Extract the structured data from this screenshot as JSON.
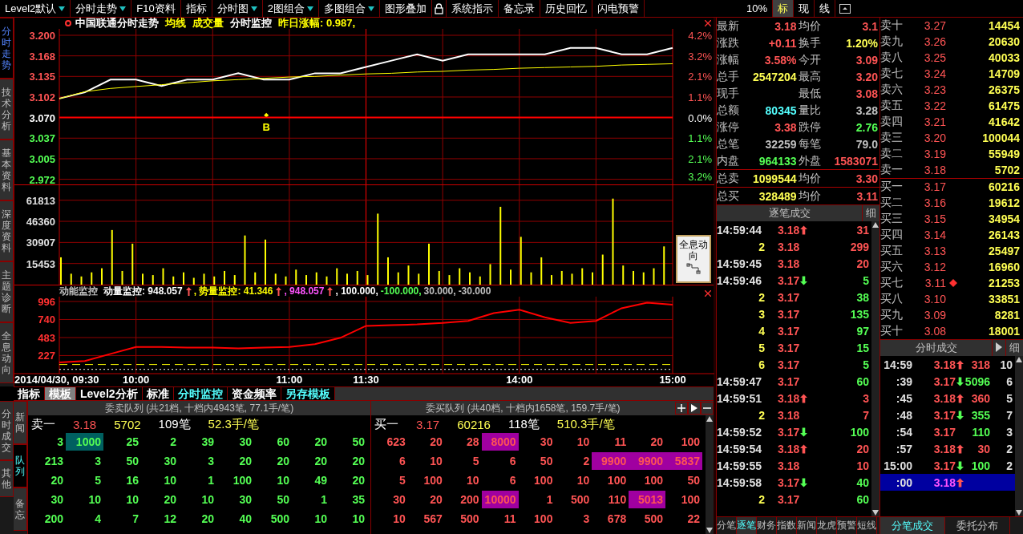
{
  "toolbar": [
    {
      "kind": "button",
      "label": "Level2默认",
      "dropdown": true
    },
    {
      "kind": "button",
      "label": "分时走势",
      "dropdown": true
    },
    {
      "kind": "button",
      "label": "F10资料",
      "dropdown": false
    },
    {
      "kind": "button",
      "label": "指标",
      "dropdown": false
    },
    {
      "kind": "button",
      "label": "分时图",
      "dropdown": true
    },
    {
      "kind": "button",
      "label": "2图组合",
      "dropdown": true
    },
    {
      "kind": "button",
      "label": "多图组合",
      "dropdown": true
    },
    {
      "kind": "button",
      "label": "图形叠加",
      "dropdown": false
    },
    {
      "kind": "lock"
    },
    {
      "kind": "button",
      "label": "系统指示",
      "dropdown": false
    },
    {
      "kind": "button",
      "label": "备忘录",
      "dropdown": false
    },
    {
      "kind": "button",
      "label": "历史回忆",
      "dropdown": false
    },
    {
      "kind": "button",
      "label": "闪电预警",
      "dropdown": false
    }
  ],
  "view": {
    "zoom": "10%",
    "modes": [
      {
        "label": "标",
        "selected": true
      },
      {
        "label": "现",
        "selected": false
      },
      {
        "label": "线",
        "selected": false
      }
    ]
  },
  "side_tabs": [
    {
      "label": "分时走势",
      "selected": true
    },
    {
      "label": "技术分析",
      "selected": false
    },
    {
      "label": "基本资料",
      "selected": false
    },
    {
      "label": "深度资料",
      "selected": false
    },
    {
      "label": "主题诊断",
      "selected": false
    },
    {
      "label": "全息动向",
      "selected": false
    }
  ],
  "chart_header": {
    "title": "中国联通分时走势",
    "items": [
      {
        "text": "成交量",
        "color": "#ffff00"
      },
      {
        "text": "分时监控",
        "color": "#ffffff"
      },
      {
        "text": "昨日涨幅: 0.987,",
        "color": "#ffff00"
      }
    ]
  },
  "price_chart": {
    "right_axis": [
      "4.2%",
      "3.2%",
      "2.1%",
      "1.1%",
      "0.0%",
      "1.1%",
      "2.1%",
      "3.2%"
    ],
    "marker": {
      "label": "B"
    },
    "chart_data": {
      "type": "line",
      "grid": true,
      "categories": [
        null,
        null,
        null,
        null,
        null,
        null,
        null,
        null,
        null,
        null,
        null,
        null,
        null,
        null,
        null,
        null,
        null,
        null,
        null,
        null,
        null,
        null,
        null,
        null,
        null
      ],
      "series": [
        {
          "color": "#ffffff",
          "values": [
            3.1,
            3.11,
            3.13,
            3.13,
            3.12,
            3.13,
            3.13,
            3.14,
            3.13,
            3.13,
            3.14,
            3.14,
            3.15,
            3.16,
            3.17,
            3.16,
            3.17,
            3.17,
            3.17,
            3.17,
            3.18,
            3.18,
            3.17,
            3.17,
            3.18
          ]
        },
        {
          "name": "均线",
          "color": "#ffff00",
          "values": [
            3.1,
            3.111,
            3.116,
            3.119,
            3.122,
            3.125,
            3.128,
            3.13,
            3.132,
            3.134,
            3.135,
            3.137,
            3.139,
            3.14,
            3.142,
            3.143,
            3.145,
            3.146,
            3.148,
            3.149,
            3.15,
            3.151,
            3.153,
            3.154,
            3.155
          ]
        },
        {
          "color": "#ff0000",
          "values": [
            3.07,
            3.07,
            3.07,
            3.07,
            3.07,
            3.07,
            3.07,
            3.07,
            3.07,
            3.07,
            3.07,
            3.07,
            3.07,
            3.07,
            3.07,
            3.07,
            3.07,
            3.07,
            3.07,
            3.07,
            3.07,
            3.07,
            3.07,
            3.07,
            3.07
          ]
        }
      ],
      "ylim": [
        2.972,
        3.2
      ],
      "yticks": [
        {
          "value": 3.2,
          "label": "3.200"
        },
        {
          "value": 3.1675,
          "label": "3.168"
        },
        {
          "value": 3.135,
          "label": "3.135"
        },
        {
          "value": 3.1025,
          "label": "3.102"
        },
        {
          "value": 3.07,
          "label": "3.070"
        },
        {
          "value": 3.0375,
          "label": "3.037"
        },
        {
          "value": 3.005,
          "label": "3.005"
        },
        {
          "value": 2.9725,
          "label": "2.972"
        }
      ]
    }
  },
  "volume_chart": {
    "chart_data": {
      "type": "bar",
      "grid": true,
      "categories": [
        null,
        null,
        null,
        null,
        null,
        null,
        null,
        null,
        null,
        null,
        null,
        null,
        null,
        null,
        null,
        null,
        null,
        null,
        null,
        null,
        null,
        null,
        null,
        null,
        null,
        null,
        null,
        null,
        null,
        null,
        null,
        null,
        null,
        null,
        null,
        null,
        null,
        null,
        null,
        null,
        null,
        null,
        null,
        null,
        null,
        null,
        null,
        null,
        null,
        null,
        null,
        null,
        null,
        null,
        null,
        null,
        null,
        null,
        null,
        null
      ],
      "values": [
        20000,
        8000,
        6000,
        9000,
        12000,
        40000,
        10000,
        30000,
        8000,
        7000,
        12000,
        6000,
        9000,
        5000,
        8000,
        6000,
        10000,
        7000,
        36000,
        9000,
        33000,
        8000,
        6000,
        11000,
        7000,
        9000,
        6000,
        12000,
        8000,
        10000,
        7000,
        52000,
        20000,
        9000,
        14000,
        8000,
        30000,
        10000,
        7000,
        12000,
        9000,
        6000,
        15000,
        57000,
        11000,
        35000,
        9000,
        20000,
        7000,
        10000,
        8000,
        12000,
        9000,
        22000,
        63000,
        14000,
        10000,
        9000,
        12000,
        28000
      ],
      "ylim": [
        0,
        64000
      ],
      "yticks": [
        {
          "value": 61813,
          "label": "61813"
        },
        {
          "value": 46360,
          "label": "46360"
        },
        {
          "value": 30907,
          "label": "30907"
        },
        {
          "value": 15453,
          "label": "15453"
        }
      ]
    }
  },
  "overlay_button": {
    "label": "全息动向"
  },
  "indicator_header": {
    "title": "动能监控",
    "items": [
      {
        "text": ": 948.057",
        "color": "#ffffff",
        "arrow": true
      },
      {
        "text": ", 势量监控: 41.346",
        "color": "#ffff00",
        "arrow": true
      },
      {
        "text": ", 948.057",
        "color": "#ff54ff",
        "arrow": true
      },
      {
        "text": ", 100.000,",
        "color": "#ffffff",
        "arrow": false
      },
      {
        "text": "-100.000,",
        "color": "#54ff54",
        "arrow": false
      },
      {
        "text": "30.000,",
        "color": "#c0c0c0",
        "arrow": false
      },
      {
        "text": "-30.000",
        "color": "#c0c0c0",
        "arrow": false
      }
    ]
  },
  "indicator_chart": {
    "chart_data": {
      "type": "line",
      "grid": true,
      "categories": [
        "2014/04/30, 09:30",
        null,
        null,
        "10:00",
        null,
        null,
        null,
        null,
        null,
        "11:00",
        null,
        null,
        "11:30",
        null,
        null,
        null,
        null,
        null,
        "14:00",
        null,
        null,
        null,
        null,
        null,
        "15:00"
      ],
      "series": [
        {
          "name": "动量监控",
          "color": "#ff0000",
          "values": [
            130,
            150,
            250,
            350,
            350,
            340,
            340,
            330,
            340,
            350,
            390,
            480,
            650,
            660,
            670,
            690,
            720,
            830,
            880,
            770,
            690,
            720,
            900,
            980,
            950
          ]
        },
        {
          "color": "#ffff00",
          "line_style": "dashed",
          "values": [
            100,
            100,
            100,
            100,
            100,
            100,
            100,
            100,
            100,
            100,
            100,
            100,
            100,
            100,
            100,
            100,
            100,
            100,
            100,
            100,
            100,
            100,
            100,
            100,
            100
          ]
        },
        {
          "color": "#ffffff",
          "line_style": "dotted",
          "values": [
            30,
            30,
            30,
            30,
            30,
            30,
            30,
            30,
            30,
            30,
            30,
            30,
            30,
            30,
            30,
            30,
            30,
            30,
            30,
            30,
            30,
            30,
            30,
            30,
            30
          ]
        }
      ],
      "ylim": [
        -30,
        996
      ],
      "yticks": [
        {
          "value": 996,
          "label": "996"
        },
        {
          "value": 740,
          "label": "740"
        },
        {
          "value": 483,
          "label": "483"
        },
        {
          "value": 227,
          "label": "227"
        }
      ]
    }
  },
  "chart_tabs": [
    {
      "label": "指标",
      "selected": false,
      "highlighted": false
    },
    {
      "label": "模板",
      "selected": true,
      "highlighted": false
    },
    {
      "label": "Level2分析",
      "selected": false,
      "highlighted": false
    },
    {
      "label": "标准",
      "selected": false,
      "highlighted": false
    },
    {
      "label": "分时监控",
      "selected": false,
      "highlighted": true
    },
    {
      "label": "资金频率",
      "selected": false,
      "highlighted": false
    },
    {
      "label": "另存模板",
      "selected": false,
      "highlighted": true
    }
  ],
  "outer_tabs": [
    {
      "label": "分时成交",
      "selected": false
    },
    {
      "label": "其他",
      "selected": false
    }
  ],
  "inner_tabs": [
    {
      "label": "新闻",
      "selected": false
    },
    {
      "label": "队列",
      "selected": true
    },
    {
      "label": "备忘",
      "selected": false
    }
  ],
  "queues": [
    {
      "kind": "sell",
      "title": "委卖队列 (共21档, 十档内4943笔, 77.1手/笔)",
      "summary": [
        {
          "text": "卖一",
          "color": "#ffffff"
        },
        {
          "text": "3.18",
          "color": "#ff5454"
        },
        {
          "text": "5702",
          "color": "#ffff54"
        },
        {
          "text": "109笔",
          "color": "#ffffff"
        },
        {
          "text": "52.3手/笔",
          "color": "#ffff54"
        }
      ],
      "rows": [
        [
          {
            "value": "3",
            "highlighted": false
          },
          {
            "value": "1000",
            "highlighted": true
          },
          {
            "value": "25",
            "highlighted": false
          },
          {
            "value": "2",
            "highlighted": false
          },
          {
            "value": "39",
            "highlighted": false
          },
          {
            "value": "30",
            "highlighted": false
          },
          {
            "value": "60",
            "highlighted": false
          },
          {
            "value": "20",
            "highlighted": false
          },
          {
            "value": "50",
            "highlighted": false
          }
        ],
        [
          {
            "value": "213",
            "highlighted": false
          },
          {
            "value": "3",
            "highlighted": false
          },
          {
            "value": "50",
            "highlighted": false
          },
          {
            "value": "30",
            "highlighted": false
          },
          {
            "value": "3",
            "highlighted": false
          },
          {
            "value": "20",
            "highlighted": false
          },
          {
            "value": "20",
            "highlighted": false
          },
          {
            "value": "20",
            "highlighted": false
          },
          {
            "value": "20",
            "highlighted": false
          }
        ],
        [
          {
            "value": "20",
            "highlighted": false
          },
          {
            "value": "5",
            "highlighted": false
          },
          {
            "value": "16",
            "highlighted": false
          },
          {
            "value": "10",
            "highlighted": false
          },
          {
            "value": "1",
            "highlighted": false
          },
          {
            "value": "100",
            "highlighted": false
          },
          {
            "value": "10",
            "highlighted": false
          },
          {
            "value": "49",
            "highlighted": false
          },
          {
            "value": "20",
            "highlighted": false
          }
        ],
        [
          {
            "value": "30",
            "highlighted": false
          },
          {
            "value": "10",
            "highlighted": false
          },
          {
            "value": "10",
            "highlighted": false
          },
          {
            "value": "20",
            "highlighted": false
          },
          {
            "value": "10",
            "highlighted": false
          },
          {
            "value": "30",
            "highlighted": false
          },
          {
            "value": "50",
            "highlighted": false
          },
          {
            "value": "1",
            "highlighted": false
          },
          {
            "value": "35",
            "highlighted": false
          }
        ],
        [
          {
            "value": "200",
            "highlighted": false
          },
          {
            "value": "4",
            "highlighted": false
          },
          {
            "value": "7",
            "highlighted": false
          },
          {
            "value": "12",
            "highlighted": false
          },
          {
            "value": "20",
            "highlighted": false
          },
          {
            "value": "40",
            "highlighted": false
          },
          {
            "value": "500",
            "highlighted": false
          },
          {
            "value": "10",
            "highlighted": false
          },
          {
            "value": "10",
            "highlighted": false
          }
        ]
      ]
    },
    {
      "kind": "buy",
      "title": "委买队列 (共40档, 十档内1658笔, 159.7手/笔)",
      "summary": [
        {
          "text": "买一",
          "color": "#ffffff"
        },
        {
          "text": "3.17",
          "color": "#ff5454"
        },
        {
          "text": "60216",
          "color": "#ffff54"
        },
        {
          "text": "118笔",
          "color": "#ffffff"
        },
        {
          "text": "510.3手/笔",
          "color": "#ffff54"
        }
      ],
      "rows": [
        [
          {
            "value": "623",
            "highlighted": false
          },
          {
            "value": "20",
            "highlighted": false
          },
          {
            "value": "28",
            "highlighted": false
          },
          {
            "value": "8000",
            "highlighted": true
          },
          {
            "value": "30",
            "highlighted": false
          },
          {
            "value": "10",
            "highlighted": false
          },
          {
            "value": "11",
            "highlighted": false
          },
          {
            "value": "20",
            "highlighted": false
          },
          {
            "value": "100",
            "highlighted": false
          }
        ],
        [
          {
            "value": "6",
            "highlighted": false
          },
          {
            "value": "10",
            "highlighted": false
          },
          {
            "value": "5",
            "highlighted": false
          },
          {
            "value": "6",
            "highlighted": false
          },
          {
            "value": "50",
            "highlighted": false
          },
          {
            "value": "2",
            "highlighted": false
          },
          {
            "value": "9900",
            "highlighted": true
          },
          {
            "value": "9900",
            "highlighted": true
          },
          {
            "value": "5837",
            "highlighted": true
          }
        ],
        [
          {
            "value": "5",
            "highlighted": false
          },
          {
            "value": "100",
            "highlighted": false
          },
          {
            "value": "10",
            "highlighted": false
          },
          {
            "value": "6",
            "highlighted": false
          },
          {
            "value": "100",
            "highlighted": false
          },
          {
            "value": "10",
            "highlighted": false
          },
          {
            "value": "100",
            "highlighted": false
          },
          {
            "value": "100",
            "highlighted": false
          },
          {
            "value": "50",
            "highlighted": false
          }
        ],
        [
          {
            "value": "30",
            "highlighted": false
          },
          {
            "value": "20",
            "highlighted": false
          },
          {
            "value": "200",
            "highlighted": false
          },
          {
            "value": "10000",
            "highlighted": true
          },
          {
            "value": "1",
            "highlighted": false
          },
          {
            "value": "500",
            "highlighted": false
          },
          {
            "value": "110",
            "highlighted": false
          },
          {
            "value": "5013",
            "highlighted": true
          },
          {
            "value": "100",
            "highlighted": false
          }
        ],
        [
          {
            "value": "10",
            "highlighted": false
          },
          {
            "value": "567",
            "highlighted": false
          },
          {
            "value": "500",
            "highlighted": false
          },
          {
            "value": "11",
            "highlighted": false
          },
          {
            "value": "100",
            "highlighted": false
          },
          {
            "value": "3",
            "highlighted": false
          },
          {
            "value": "678",
            "highlighted": false
          },
          {
            "value": "500",
            "highlighted": false
          },
          {
            "value": "22",
            "highlighted": false
          }
        ]
      ]
    }
  ],
  "quote": [
    [
      {
        "label": "最新",
        "value": "3.18",
        "color": "#ff5454"
      },
      {
        "label": "均价",
        "value": "3.1",
        "color": "#ff5454"
      }
    ],
    [
      {
        "label": "涨跌",
        "value": "+0.11",
        "color": "#ff5454"
      },
      {
        "label": "换手",
        "value": "1.20%",
        "color": "#ffff54"
      }
    ],
    [
      {
        "label": "涨幅",
        "value": "3.58%",
        "color": "#ff5454"
      },
      {
        "label": "今开",
        "value": "3.09",
        "color": "#ff5454"
      }
    ],
    [
      {
        "label": "总手",
        "value": "2547204",
        "color": "#ffff54"
      },
      {
        "label": "最高",
        "value": "3.20",
        "color": "#ff5454"
      }
    ],
    [
      {
        "label": "现手"
      },
      {
        "label": "最低",
        "value": "3.08",
        "color": "#ff5454"
      }
    ],
    [
      {
        "label": "总额",
        "value": "80345",
        "color": "#54ffff"
      },
      {
        "label": "量比",
        "value": "3.28",
        "color": "#c0c0c0"
      }
    ],
    [
      {
        "label": "涨停",
        "value": "3.38",
        "color": "#ff5454"
      },
      {
        "label": "跌停",
        "value": "2.76",
        "color": "#54ff54"
      }
    ],
    [
      {
        "label": "总笔",
        "value": "32259",
        "color": "#c0c0c0"
      },
      {
        "label": "每笔",
        "value": "79.0",
        "color": "#c0c0c0"
      }
    ],
    [
      {
        "label": "内盘",
        "value": "964133",
        "color": "#54ff54"
      },
      {
        "label": "外盘",
        "value": "1583071",
        "color": "#ff5454"
      }
    ],
    [
      {
        "label": "总卖",
        "value": "1099544",
        "color": "#ffff54"
      },
      {
        "label": "均价",
        "value": "3.30",
        "color": "#ff5454"
      }
    ],
    [
      {
        "label": "总买",
        "value": "328489",
        "color": "#ffff54"
      },
      {
        "label": "均价",
        "value": "3.11",
        "color": "#ff5454"
      }
    ]
  ],
  "book": [
    {
      "label": "卖十",
      "price": "3.27",
      "volume": "14454",
      "marked": false
    },
    {
      "label": "卖九",
      "price": "3.26",
      "volume": "20630",
      "marked": false
    },
    {
      "label": "卖八",
      "price": "3.25",
      "volume": "40033",
      "marked": false
    },
    {
      "label": "卖七",
      "price": "3.24",
      "volume": "14709",
      "marked": false
    },
    {
      "label": "卖六",
      "price": "3.23",
      "volume": "26375",
      "marked": false
    },
    {
      "label": "卖五",
      "price": "3.22",
      "volume": "61475",
      "marked": false
    },
    {
      "label": "卖四",
      "price": "3.21",
      "volume": "41642",
      "marked": false
    },
    {
      "label": "卖三",
      "price": "3.20",
      "volume": "100044",
      "marked": false
    },
    {
      "label": "卖二",
      "price": "3.19",
      "volume": "55949",
      "marked": false
    },
    {
      "label": "卖一",
      "price": "3.18",
      "volume": "5702",
      "marked": false
    },
    {
      "label": "买一",
      "price": "3.17",
      "volume": "60216",
      "marked": false
    },
    {
      "label": "买二",
      "price": "3.16",
      "volume": "19612",
      "marked": false
    },
    {
      "label": "买三",
      "price": "3.15",
      "volume": "34954",
      "marked": false
    },
    {
      "label": "买四",
      "price": "3.14",
      "volume": "26143",
      "marked": false
    },
    {
      "label": "买五",
      "price": "3.13",
      "volume": "25497",
      "marked": false
    },
    {
      "label": "买六",
      "price": "3.12",
      "volume": "16960",
      "marked": false
    },
    {
      "label": "买七",
      "price": "3.11",
      "volume": "21253",
      "marked": true
    },
    {
      "label": "买八",
      "price": "3.10",
      "volume": "33851",
      "marked": false
    },
    {
      "label": "买九",
      "price": "3.09",
      "volume": "8281",
      "marked": false
    },
    {
      "label": "买十",
      "price": "3.08",
      "volume": "18001",
      "marked": false
    }
  ],
  "ticks": {
    "title": "逐笔成交",
    "detail": "细",
    "rows": [
      {
        "kind": "time",
        "time": "14:59:44",
        "price": "3.18",
        "rising": true,
        "falling": false,
        "volume": "31",
        "buy": true
      },
      {
        "kind": "seq",
        "time": "2",
        "price": "3.18",
        "rising": false,
        "falling": false,
        "volume": "299",
        "buy": true
      },
      {
        "kind": "time",
        "time": "14:59:45",
        "price": "3.18",
        "rising": false,
        "falling": false,
        "volume": "20",
        "buy": true
      },
      {
        "kind": "time",
        "time": "14:59:46",
        "price": "3.17",
        "rising": false,
        "falling": true,
        "volume": "5",
        "buy": false
      },
      {
        "kind": "seq",
        "time": "2",
        "price": "3.17",
        "rising": false,
        "falling": false,
        "volume": "38",
        "buy": false
      },
      {
        "kind": "seq",
        "time": "3",
        "price": "3.17",
        "rising": false,
        "falling": false,
        "volume": "135",
        "buy": false
      },
      {
        "kind": "seq",
        "time": "4",
        "price": "3.17",
        "rising": false,
        "falling": false,
        "volume": "97",
        "buy": false
      },
      {
        "kind": "seq",
        "time": "5",
        "price": "3.17",
        "rising": false,
        "falling": false,
        "volume": "15",
        "buy": false
      },
      {
        "kind": "seq",
        "time": "6",
        "price": "3.17",
        "rising": false,
        "falling": false,
        "volume": "5",
        "buy": false
      },
      {
        "kind": "time",
        "time": "14:59:47",
        "price": "3.17",
        "rising": false,
        "falling": false,
        "volume": "60",
        "buy": false
      },
      {
        "kind": "time",
        "time": "14:59:51",
        "price": "3.18",
        "rising": true,
        "falling": false,
        "volume": "3",
        "buy": true
      },
      {
        "kind": "seq",
        "time": "2",
        "price": "3.18",
        "rising": false,
        "falling": false,
        "volume": "7",
        "buy": true
      },
      {
        "kind": "time",
        "time": "14:59:52",
        "price": "3.17",
        "rising": false,
        "falling": true,
        "volume": "100",
        "buy": false
      },
      {
        "kind": "time",
        "time": "14:59:54",
        "price": "3.18",
        "rising": true,
        "falling": false,
        "volume": "20",
        "buy": true
      },
      {
        "kind": "time",
        "time": "14:59:55",
        "price": "3.18",
        "rising": false,
        "falling": false,
        "volume": "10",
        "buy": true
      },
      {
        "kind": "time",
        "time": "14:59:58",
        "price": "3.17",
        "rising": false,
        "falling": true,
        "volume": "40",
        "buy": false
      },
      {
        "kind": "seq",
        "time": "2",
        "price": "3.17",
        "rising": false,
        "falling": false,
        "volume": "60",
        "buy": false
      }
    ],
    "tabs": [
      {
        "label": "分笔",
        "selected": false
      },
      {
        "label": "逐笔",
        "selected": true
      },
      {
        "label": "财务",
        "selected": false
      },
      {
        "label": "指数",
        "selected": false
      },
      {
        "label": "新闻",
        "selected": false
      },
      {
        "label": "龙虎",
        "selected": false
      },
      {
        "label": "预警",
        "selected": false
      },
      {
        "label": "短线",
        "selected": false
      }
    ]
  },
  "minute_trades": {
    "title": "分时成交",
    "detail": "细",
    "rows": [
      {
        "time": "14:59",
        "price": "3.18",
        "rising": true,
        "falling": false,
        "volume": "318",
        "buy": true,
        "count": "10",
        "selected": false
      },
      {
        "time": ":39",
        "price": "3.17",
        "rising": false,
        "falling": true,
        "volume": "5096",
        "buy": false,
        "count": "6",
        "selected": false
      },
      {
        "time": ":45",
        "price": "3.18",
        "rising": true,
        "falling": false,
        "volume": "360",
        "buy": true,
        "count": "5",
        "selected": false
      },
      {
        "time": ":48",
        "price": "3.17",
        "rising": false,
        "falling": true,
        "volume": "355",
        "buy": false,
        "count": "7",
        "selected": false
      },
      {
        "time": ":54",
        "price": "3.17",
        "rising": false,
        "falling": false,
        "volume": "110",
        "buy": false,
        "count": "3",
        "selected": false
      },
      {
        "time": ":57",
        "price": "3.18",
        "rising": true,
        "falling": false,
        "volume": "30",
        "buy": true,
        "count": "2",
        "selected": false
      },
      {
        "time": "15:00",
        "price": "3.17",
        "rising": false,
        "falling": true,
        "volume": "100",
        "buy": false,
        "count": "2",
        "selected": false
      },
      {
        "time": ":00",
        "price": "3.18",
        "rising": true,
        "falling": false,
        "selected": true
      }
    ],
    "tabs": [
      {
        "label": "分笔成交",
        "selected": true
      },
      {
        "label": "委托分布",
        "selected": false
      }
    ]
  }
}
